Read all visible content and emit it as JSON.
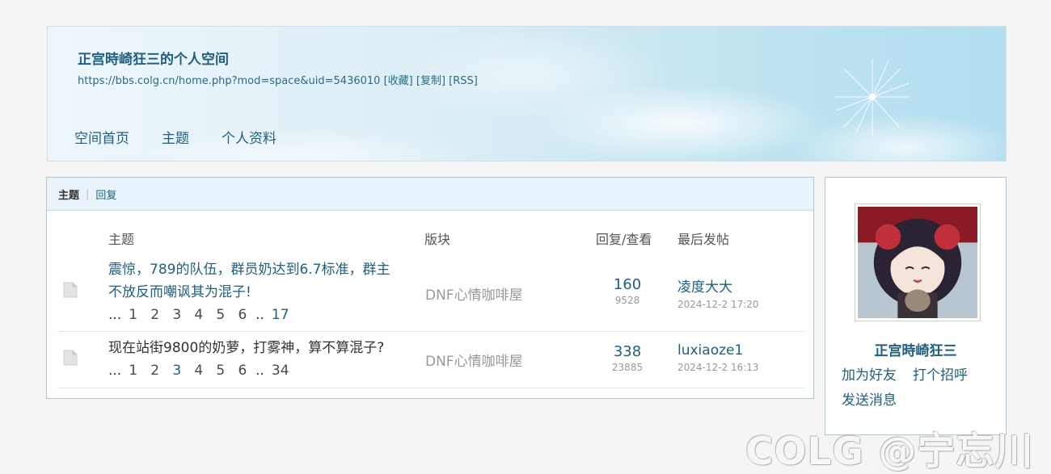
{
  "header": {
    "title": "正宫時崎狂三的个人空间",
    "url": "https://bbs.colg.cn/home.php?mod=space&uid=5436010",
    "fav_label": "[收藏]",
    "copy_label": "[复制]",
    "rss_label": "[RSS]",
    "nav": [
      "空间首页",
      "主题",
      "个人资料"
    ]
  },
  "tabs": {
    "active": "主题",
    "other": "回复"
  },
  "columns": {
    "subject": "主题",
    "forum": "版块",
    "stats": "回复/查看",
    "last": "最后发帖"
  },
  "threads": [
    {
      "title_line1": "震惊，789的队伍，群员奶达到6.7标准，群主",
      "title_line2": "不放反而嘲讽其为混子!",
      "pages": [
        "...",
        "1",
        "2",
        "3",
        "4",
        "5",
        "6",
        "..",
        "17"
      ],
      "forum": "DNF心情咖啡屋",
      "replies": "160",
      "views": "9528",
      "last_author": "凌度大大",
      "last_time": "2024-12-2 17:20"
    },
    {
      "title_line1": "现在站街9800的奶萝，打雾神，算不算混子?",
      "pages": [
        "...",
        "1",
        "2",
        "3",
        "4",
        "5",
        "6",
        "..",
        "34"
      ],
      "forum": "DNF心情咖啡屋",
      "replies": "338",
      "views": "23885",
      "last_author": "luxiaoze1",
      "last_time": "2024-12-2 16:13"
    }
  ],
  "profile": {
    "name": "正宫時崎狂三",
    "add_friend": "加为好友",
    "greet": "打个招呼",
    "message": "发送消息"
  },
  "watermark": "COLG @宁忘川",
  "colors": {
    "link": "#1f5f82",
    "muted": "#999999",
    "panel_border": "#a9c7d8",
    "tab_bg": "#e8f3fb"
  }
}
